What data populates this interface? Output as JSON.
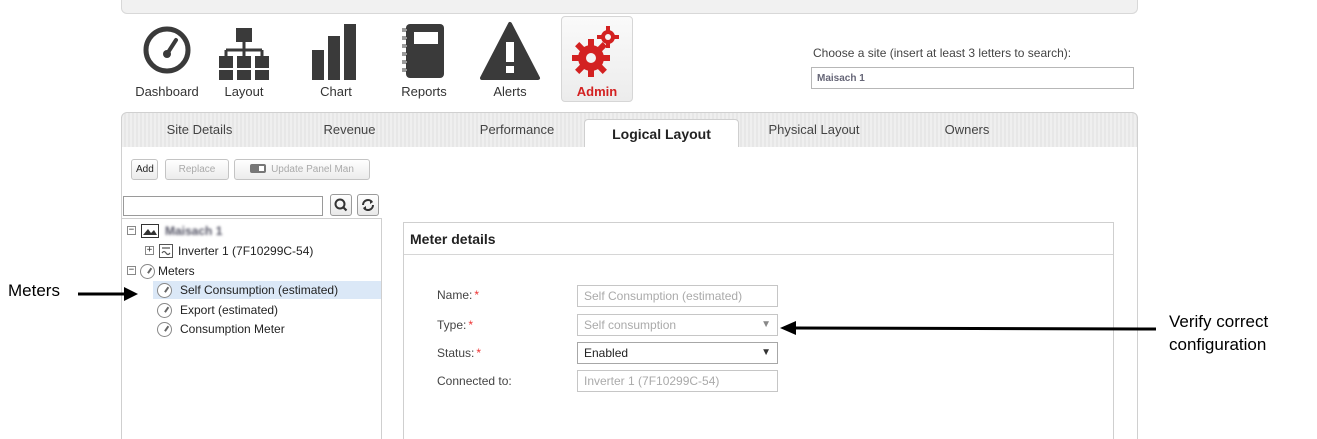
{
  "nav": {
    "dashboard": "Dashboard",
    "layout": "Layout",
    "chart": "Chart",
    "reports": "Reports",
    "alerts": "Alerts",
    "admin": "Admin",
    "active_color": "#d32121"
  },
  "site_search": {
    "label": "Choose a site (insert at least 3 letters to search):",
    "value": "Maisach 1"
  },
  "tabs": [
    "Site Details",
    "Revenue",
    "Performance",
    "Logical Layout",
    "Physical Layout",
    "Owners"
  ],
  "active_tab": "Logical Layout",
  "toolbar": {
    "add": "Add",
    "replace": "Replace",
    "update_panel": "Update Panel Man"
  },
  "tree": {
    "site": "Maisach 1",
    "inverter": "Inverter 1 (7F10299C-54)",
    "meters": "Meters",
    "items": [
      "Self Consumption (estimated)",
      "Export (estimated)",
      "Consumption Meter"
    ],
    "selected_index": 0
  },
  "meter_details": {
    "title": "Meter details",
    "name_label": "Name:",
    "name_value": "Self Consumption (estimated)",
    "type_label": "Type:",
    "type_value": "Self consumption",
    "status_label": "Status:",
    "status_value": "Enabled",
    "connected_label": "Connected to:",
    "connected_value": "Inverter 1 (7F10299C-54)",
    "required_mark": "*"
  },
  "annotations": {
    "meters": "Meters",
    "verify_line1": "Verify correct",
    "verify_line2": "configuration"
  }
}
